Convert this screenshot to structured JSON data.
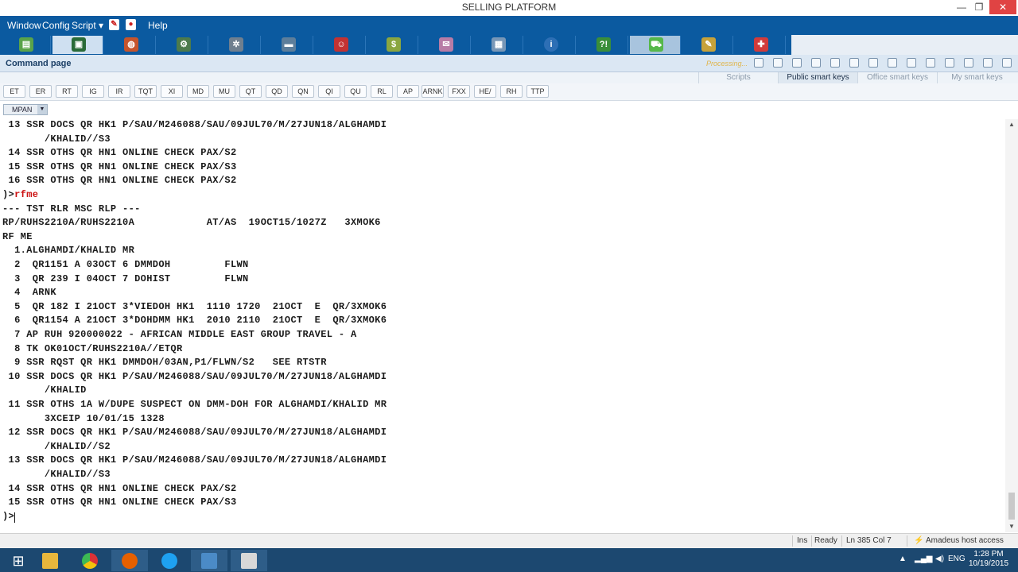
{
  "window": {
    "title": "SELLING PLATFORM",
    "minimize": "—",
    "restore": "❐",
    "close": "✕"
  },
  "menu": {
    "items": [
      "Window",
      "Config",
      "Script ▾",
      "Help"
    ]
  },
  "toolbar": {
    "icons": [
      "book-icon",
      "selected-tool-icon",
      "globe-user-icon",
      "robot-icon",
      "settings-cog-icon",
      "car-icon",
      "person-icon",
      "coins-icon",
      "document-icon",
      "reports-icon",
      "info-icon",
      "help-icon",
      "cart-icon",
      "pencil-icon",
      "pin-icon"
    ]
  },
  "command_page": {
    "label": "Command page",
    "processing": "Processing..."
  },
  "smart_key_tabs": [
    "Scripts",
    "Public smart keys",
    "Office smart keys",
    "My smart keys"
  ],
  "keys": [
    "ET",
    "ER",
    "RT",
    "IG",
    "IR",
    "TQT",
    "XI",
    "MD",
    "MU",
    "QT",
    "QD",
    "QN",
    "QI",
    "QU",
    "RL",
    "AP",
    "ARNK",
    "FXX",
    "HE/",
    "RH",
    "TTP"
  ],
  "mpan": "MPAN",
  "terminal": {
    "lines": [
      {
        "text": " 13 SSR DOCS QR HK1 P/SAU/M246088/SAU/09JUL70/M/27JUN18/ALGHAMDI",
        "type": "out"
      },
      {
        "text": "       /KHALID//S3",
        "type": "out"
      },
      {
        "text": " 14 SSR OTHS QR HN1 ONLINE CHECK PAX/S2",
        "type": "out"
      },
      {
        "text": " 15 SSR OTHS QR HN1 ONLINE CHECK PAX/S3",
        "type": "out"
      },
      {
        "text": " 16 SSR OTHS QR HN1 ONLINE CHECK PAX/S2",
        "type": "out"
      },
      {
        "text": ")>",
        "type": "prompt",
        "cmd": "rfme"
      },
      {
        "text": "--- TST RLR MSC RLP ---",
        "type": "out"
      },
      {
        "text": "RP/RUHS2210A/RUHS2210A            AT/AS  19OCT15/1027Z   3XMOK6",
        "type": "out"
      },
      {
        "text": "RF ME",
        "type": "out"
      },
      {
        "text": "  1.ALGHAMDI/KHALID MR",
        "type": "out"
      },
      {
        "text": "  2  QR1151 A 03OCT 6 DMMDOH         FLWN",
        "type": "out"
      },
      {
        "text": "  3  QR 239 I 04OCT 7 DOHIST         FLWN",
        "type": "out"
      },
      {
        "text": "  4  ARNK",
        "type": "out"
      },
      {
        "text": "  5  QR 182 I 21OCT 3*VIEDOH HK1  1110 1720  21OCT  E  QR/3XMOK6",
        "type": "out"
      },
      {
        "text": "  6  QR1154 A 21OCT 3*DOHDMM HK1  2010 2110  21OCT  E  QR/3XMOK6",
        "type": "out"
      },
      {
        "text": "  7 AP RUH 920000022 - AFRICAN MIDDLE EAST GROUP TRAVEL - A",
        "type": "out"
      },
      {
        "text": "  8 TK OK01OCT/RUHS2210A//ETQR",
        "type": "out"
      },
      {
        "text": "  9 SSR RQST QR HK1 DMMDOH/03AN,P1/FLWN/S2   SEE RTSTR",
        "type": "out"
      },
      {
        "text": " 10 SSR DOCS QR HK1 P/SAU/M246088/SAU/09JUL70/M/27JUN18/ALGHAMDI",
        "type": "out"
      },
      {
        "text": "       /KHALID",
        "type": "out"
      },
      {
        "text": " 11 SSR OTHS 1A W/DUPE SUSPECT ON DMM-DOH FOR ALGHAMDI/KHALID MR",
        "type": "out"
      },
      {
        "text": "       3XCEIP 10/01/15 1328",
        "type": "out"
      },
      {
        "text": " 12 SSR DOCS QR HK1 P/SAU/M246088/SAU/09JUL70/M/27JUN18/ALGHAMDI",
        "type": "out"
      },
      {
        "text": "       /KHALID//S2",
        "type": "out"
      },
      {
        "text": " 13 SSR DOCS QR HK1 P/SAU/M246088/SAU/09JUL70/M/27JUN18/ALGHAMDI",
        "type": "out"
      },
      {
        "text": "       /KHALID//S3",
        "type": "out"
      },
      {
        "text": " 14 SSR OTHS QR HN1 ONLINE CHECK PAX/S2",
        "type": "out"
      },
      {
        "text": " 15 SSR OTHS QR HN1 ONLINE CHECK PAX/S3",
        "type": "out"
      },
      {
        "text": ")>",
        "type": "prompt",
        "cmd": ""
      }
    ]
  },
  "status": {
    "ins": "Ins",
    "ready": "Ready",
    "position": "Ln 385 Col 7",
    "host": "Amadeus host access"
  },
  "taskbar": {
    "apps": [
      "windows-start-icon",
      "file-explorer-icon",
      "chrome-icon",
      "firefox-icon",
      "internet-explorer-icon",
      "amadeus-app-icon",
      "selling-platform-icon"
    ],
    "lang": "ENG",
    "time": "1:28 PM",
    "date": "10/19/2015"
  },
  "colors": {
    "menu_bg": "#0b5aa0",
    "command_text": "#cc1111",
    "close_button": "#e04343",
    "taskbar": "#1c4870"
  }
}
